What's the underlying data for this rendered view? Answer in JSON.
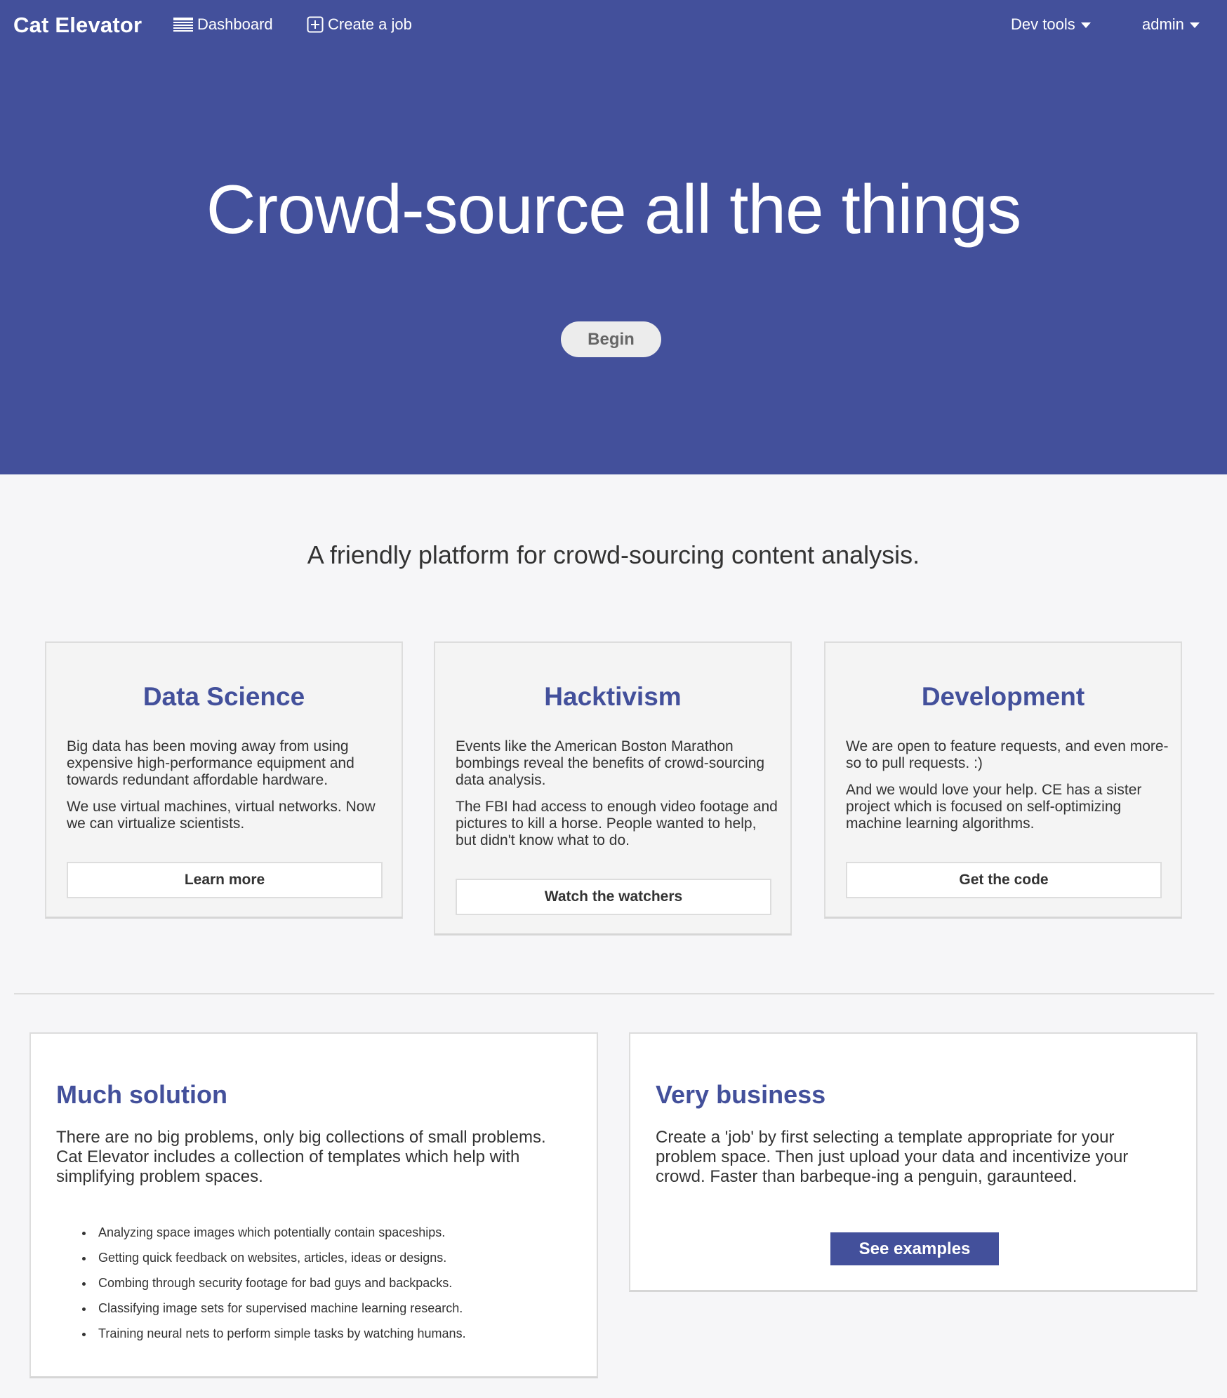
{
  "nav": {
    "brand": "Cat Elevator",
    "dashboard": "Dashboard",
    "create_job": "Create a job",
    "dev_tools": "Dev tools",
    "admin": "admin",
    "icons": {
      "dashboard": "list-icon",
      "create_job": "plus-square-icon",
      "dropdown": "caret-down-icon"
    }
  },
  "hero": {
    "title": "Crowd-source all the things",
    "begin": "Begin"
  },
  "tagline": "A friendly platform for crowd-sourcing content analysis.",
  "cards": [
    {
      "title": "Data Science",
      "paragraphs": [
        "Big data has been moving away from using expensive high-performance equipment and towards redundant affordable hardware.",
        "We use virtual machines, virtual networks. Now we can virtualize scientists."
      ],
      "button": "Learn more"
    },
    {
      "title": "Hacktivism",
      "paragraphs": [
        "Events like the American Boston Marathon bombings reveal the benefits of crowd-sourcing data analysis.",
        "The FBI had access to enough video footage and pictures to kill a horse. People wanted to help, but didn't know what to do."
      ],
      "button": "Watch the watchers"
    },
    {
      "title": "Development",
      "paragraphs": [
        "We are open to feature requests, and even more-so to pull requests. :)",
        "And we would love your help. CE has a sister project which is focused on self-optimizing machine learning algorithms."
      ],
      "button": "Get the code"
    }
  ],
  "panels": {
    "solution": {
      "title": "Much solution",
      "text": "There are no big problems, only big collections of small problems. Cat Elevator includes a collection of templates which help with simplifying problem spaces.",
      "items": [
        "Analyzing space images which potentially contain spaceships.",
        "Getting quick feedback on websites, articles, ideas or designs.",
        "Combing through security footage for bad guys and backpacks.",
        "Classifying image sets for supervised machine learning research.",
        "Training neural nets to perform simple tasks by watching humans."
      ]
    },
    "business": {
      "title": "Very business",
      "text": "Create a 'job' by first selecting a template appropriate for your problem space. Then just upload your data and incentivize your crowd. Faster than barbeque-ing a penguin, garaunteed.",
      "button": "See examples"
    }
  },
  "colors": {
    "brand": "#43509b",
    "background": "#f6f6f8",
    "card": "#f4f4f4"
  }
}
